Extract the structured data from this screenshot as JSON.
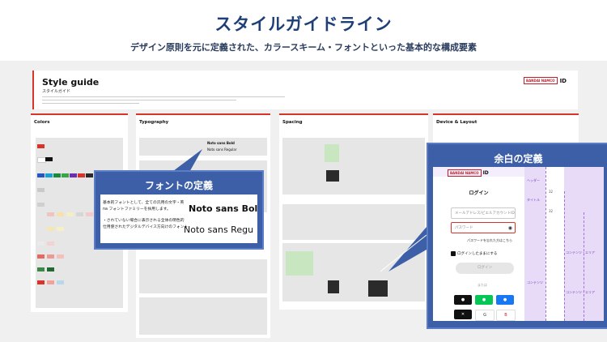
{
  "header": {
    "title": "スタイルガイドライン",
    "subtitle": "デザイン原則を元に定義された、カラースキーム・フォントといった基本的な構成要素"
  },
  "styleguide": {
    "title": "Style guide",
    "subtitle": "スタイルガイド",
    "logo_brand": "BANDAI NAMCO",
    "logo_id": "ID"
  },
  "sections": {
    "colors": "Colors",
    "typography": "Typography",
    "spacing": "Spacing",
    "device": "Device & Layout"
  },
  "typography_preview": {
    "sample_bold": "Noto sans Bold",
    "sample_regular": "Noto sans Regular"
  },
  "callout_font": {
    "title": "フォントの定義",
    "body_line1": "基本的フォントとして、全ての汎用の文字・英",
    "body_line2": "na フォントファミリーを採用します。",
    "body_line3": "・されていない場合に表示される全体の明色的",
    "body_line4": "仕用使されたデジタルデバイス方向けのフォント",
    "sample_bold": "Noto sans  Bol",
    "sample_regular": "Noto sans  Regu"
  },
  "callout_spacing": {
    "title": "余白の定義",
    "login_title": "ログイン",
    "email_placeholder": "メールアドレス/ビエルアカウントID",
    "password_placeholder": "パスワード",
    "forgot_password": "パスワードを忘れた方はこちら",
    "remember_me": "ログインしたままにする",
    "login_button": "ログイン",
    "or_label": "または",
    "label_header": "ヘッダー",
    "label_title": "タイトル",
    "label_content": "コンテンツ",
    "label_content_side": "コンテンツ・エリア",
    "label_content_side2": "コンテンツ・エリア",
    "value_32a": "32",
    "value_32b": "32"
  },
  "colors": {
    "accent_red": "#d8352a",
    "callout_blue": "#3d5fa8",
    "title_navy": "#1f3f77",
    "label_purple": "#7b3fc4"
  }
}
